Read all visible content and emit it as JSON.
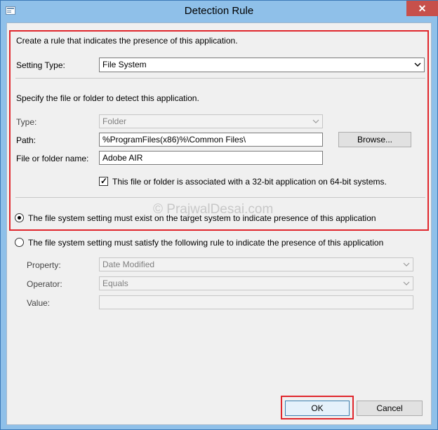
{
  "window": {
    "title": "Detection Rule",
    "close_glyph": "✕"
  },
  "intro": "Create a rule that indicates the presence of this application.",
  "setting_type": {
    "label": "Setting Type:",
    "value": "File System"
  },
  "file_section": {
    "instruction": "Specify the file or folder to detect this application.",
    "type_label": "Type:",
    "type_value": "Folder",
    "path_label": "Path:",
    "path_value": "%ProgramFiles(x86)%\\Common Files\\",
    "browse_label": "Browse...",
    "name_label": "File or folder name:",
    "name_value": "Adobe AIR",
    "bit32_label": "This file or folder is associated with a 32-bit application on 64-bit systems.",
    "bit32_checked": true
  },
  "options": {
    "exist_label": "The file system setting must exist on the target system to indicate presence of this application",
    "exist_selected": true,
    "rule_label": "The file system setting must satisfy the following rule to indicate the presence of this application",
    "rule_selected": false
  },
  "rule": {
    "property_label": "Property:",
    "property_value": "Date Modified",
    "operator_label": "Operator:",
    "operator_value": "Equals",
    "value_label": "Value:",
    "value_value": ""
  },
  "watermark": "© PrajwalDesai.com",
  "buttons": {
    "ok": "OK",
    "cancel": "Cancel"
  },
  "colors": {
    "highlight_border": "#e0262c",
    "title_bar": "#8fc0e9",
    "close_button": "#c7504b"
  }
}
